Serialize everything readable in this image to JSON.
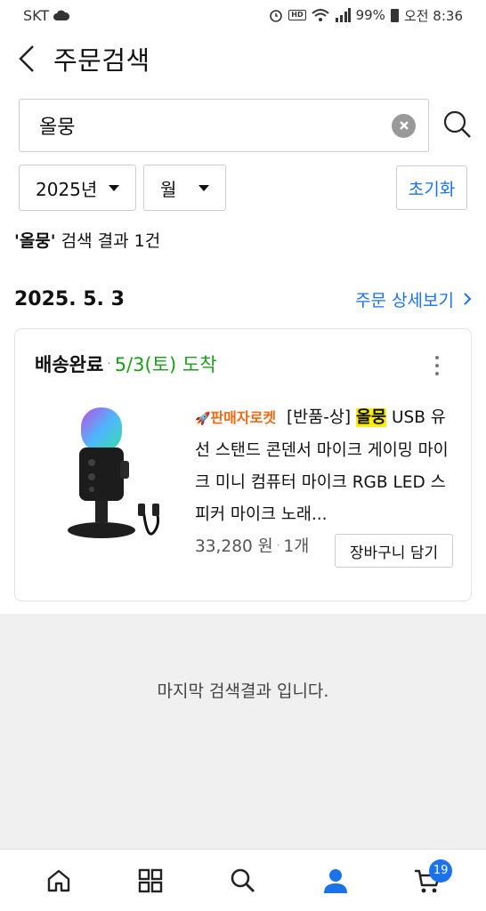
{
  "status_bar": {
    "carrier": "SKT",
    "battery": "99%",
    "time": "오전 8:36",
    "hd_badge": "HD Voice"
  },
  "header": {
    "title": "주문검색"
  },
  "search": {
    "value": "올뭉"
  },
  "filters": {
    "year": "2025년",
    "month": "월",
    "reset_label": "초기화"
  },
  "results": {
    "keyword": "'올뭉'",
    "summary_suffix": " 검색 결과 1건"
  },
  "order": {
    "date": "2025. 5. 3",
    "detail_link": "주문 상세보기",
    "status": "배송완료",
    "arrival": "5/3(토) 도착",
    "product": {
      "badge": "판매자로켓",
      "title_prefix": "[반품-상]",
      "title_highlight": "올뭉",
      "title_rest": "USB 유선 스탠드 콘덴서 마이크 게이밍 마이크 미니 컴퓨터 마이크 RGB LED 스피커 마이크 노래...",
      "price": "33,280 원",
      "quantity": "1개",
      "cart_label": "장바구니 담기"
    }
  },
  "end_message": "마지막 검색결과 입니다.",
  "bottom_nav": {
    "cart_count": "19"
  },
  "colors": {
    "accent": "#1a73e8",
    "arrival_green": "#1b9e1b",
    "rocket_orange": "#f06a14",
    "highlight": "#ffef00"
  }
}
